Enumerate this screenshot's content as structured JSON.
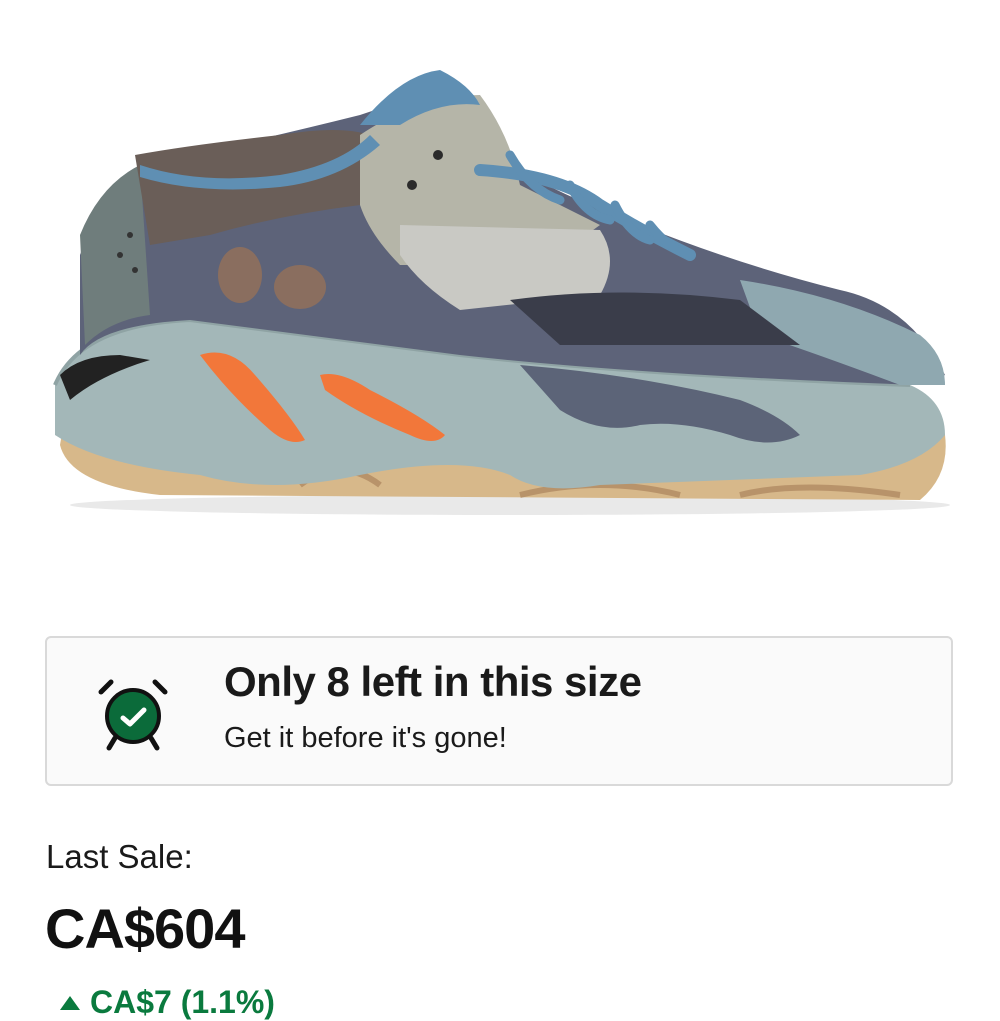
{
  "product": {
    "image_alt": "Sneaker product photo",
    "image_icon": "sneaker-product-image"
  },
  "urgency": {
    "icon": "alarm-clock-icon",
    "title": "Only 8 left in this size",
    "subtitle": "Get it before it's gone!",
    "accent_color": "#0b6b3a"
  },
  "last_sale": {
    "label": "Last Sale:",
    "price": "CA$604",
    "change": "CA$7 (1.1%)",
    "change_icon": "arrow-up-icon",
    "change_color": "#0a7a3e"
  }
}
